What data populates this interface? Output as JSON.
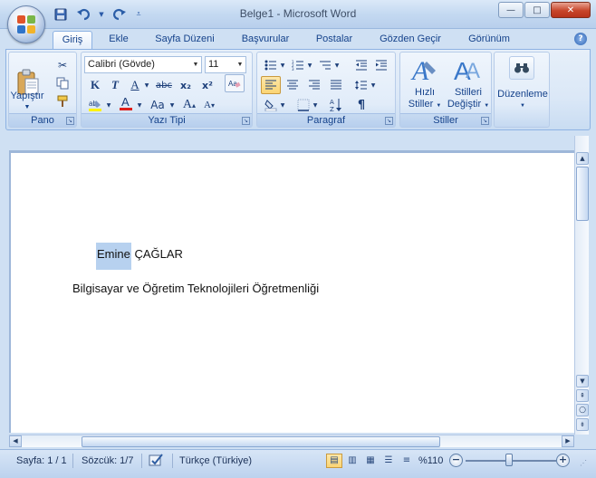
{
  "window": {
    "title": "Belge1 - Microsoft Word",
    "minimize": "—",
    "maximize": "□",
    "close": "✕"
  },
  "qat": {
    "save_icon": "save-icon",
    "undo_icon": "undo-icon",
    "redo_icon": "redo-icon"
  },
  "tabs": [
    {
      "label": "Giriş",
      "active": true
    },
    {
      "label": "Ekle"
    },
    {
      "label": "Sayfa Düzeni"
    },
    {
      "label": "Başvurular"
    },
    {
      "label": "Postalar"
    },
    {
      "label": "Gözden Geçir"
    },
    {
      "label": "Görünüm"
    }
  ],
  "help": "?",
  "ribbon": {
    "clipboard": {
      "label": "Pano",
      "paste_label": "Yapıştır"
    },
    "font": {
      "label": "Yazı Tipi",
      "font_name": "Calibri (Gövde)",
      "font_size": "11",
      "bold": "K",
      "italic": "T",
      "underline": "A",
      "strike": "abc",
      "subscript": "x₂",
      "superscript": "x²",
      "grow": "A",
      "shrink": "A",
      "change_case": "Aa"
    },
    "paragraph": {
      "label": "Paragraf"
    },
    "styles": {
      "label": "Stiller",
      "quick_styles_line1": "Hızlı",
      "quick_styles_line2": "Stiller",
      "change_styles_line1": "Stilleri",
      "change_styles_line2": "Değiştir"
    },
    "editing": {
      "label": "Düzenleme"
    }
  },
  "document": {
    "line1_selected": "Emine",
    "line1_rest": " ÇAĞLAR",
    "line2": "Bilgisayar ve Öğretim Teknolojileri Öğretmenliği"
  },
  "statusbar": {
    "page": "Sayfa: 1 / 1",
    "words": "Sözcük: 1/7",
    "language": "Türkçe (Türkiye)",
    "zoom": "%110"
  },
  "zoom_level_percent": 110
}
